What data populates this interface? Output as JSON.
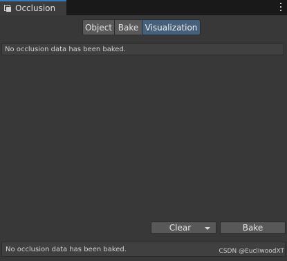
{
  "window": {
    "tab_title": "Occlusion",
    "tab_icon": "occlusion-window-icon",
    "menu_icon": "kebab-menu-icon"
  },
  "mode_tabs": [
    {
      "label": "Object",
      "active": false
    },
    {
      "label": "Bake",
      "active": false
    },
    {
      "label": "Visualization",
      "active": true
    }
  ],
  "help_message": "No occlusion data has been baked.",
  "buttons": {
    "clear_label": "Clear",
    "bake_label": "Bake"
  },
  "status_message": "No occlusion data has been baked.",
  "watermark": "CSDN @EucliwoodXT",
  "colors": {
    "accent": "#3a79bb",
    "active_tab": "#46607c",
    "background": "#383838"
  }
}
